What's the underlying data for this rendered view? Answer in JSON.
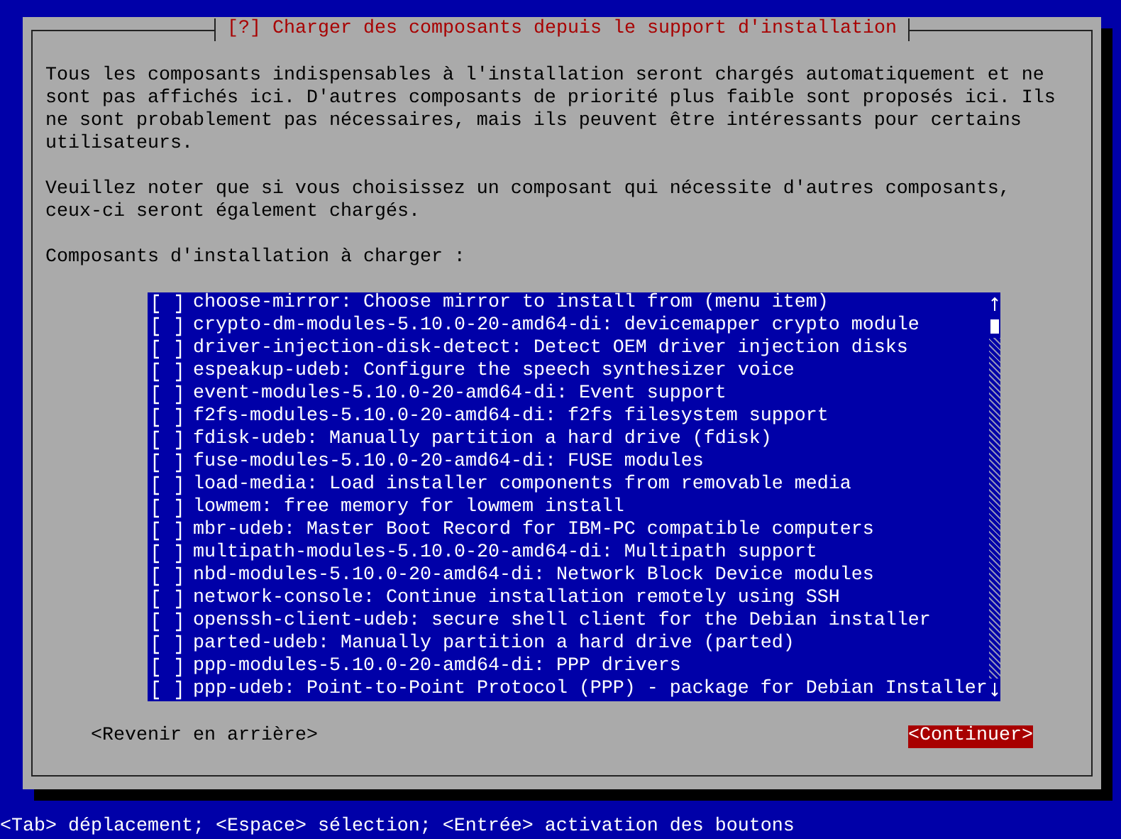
{
  "dialog": {
    "title": "[?] Charger des composants depuis le support d'installation",
    "paragraphs": [
      "Tous les composants indispensables à l'installation seront chargés automatiquement et ne sont pas affichés ici. D'autres composants de priorité plus faible sont proposés ici. Ils ne sont probablement pas nécessaires, mais ils peuvent être intéressants pour certains utilisateurs.",
      "Veuillez noter que si vous choisissez un composant qui nécessite d'autres composants, ceux-ci seront également chargés."
    ],
    "list_label": "Composants d'installation à charger :",
    "items": [
      {
        "label": "choose-mirror: Choose mirror to install from (menu item)",
        "checked": false
      },
      {
        "label": "crypto-dm-modules-5.10.0-20-amd64-di: devicemapper crypto module",
        "checked": false
      },
      {
        "label": "driver-injection-disk-detect: Detect OEM driver injection disks",
        "checked": false
      },
      {
        "label": "espeakup-udeb: Configure the speech synthesizer voice",
        "checked": false
      },
      {
        "label": "event-modules-5.10.0-20-amd64-di: Event support",
        "checked": false
      },
      {
        "label": "f2fs-modules-5.10.0-20-amd64-di: f2fs filesystem support",
        "checked": false
      },
      {
        "label": "fdisk-udeb: Manually partition a hard drive (fdisk)",
        "checked": false
      },
      {
        "label": "fuse-modules-5.10.0-20-amd64-di: FUSE modules",
        "checked": false
      },
      {
        "label": "load-media: Load installer components from removable media",
        "checked": false
      },
      {
        "label": "lowmem: free memory for lowmem install",
        "checked": false
      },
      {
        "label": "mbr-udeb: Master Boot Record for IBM-PC compatible computers",
        "checked": false
      },
      {
        "label": "multipath-modules-5.10.0-20-amd64-di: Multipath support",
        "checked": false
      },
      {
        "label": "nbd-modules-5.10.0-20-amd64-di: Network Block Device modules",
        "checked": false
      },
      {
        "label": "network-console: Continue installation remotely using SSH",
        "checked": false
      },
      {
        "label": "openssh-client-udeb: secure shell client for the Debian installer",
        "checked": false
      },
      {
        "label": "parted-udeb: Manually partition a hard drive (parted)",
        "checked": false
      },
      {
        "label": "ppp-modules-5.10.0-20-amd64-di: PPP drivers",
        "checked": false
      },
      {
        "label": "ppp-udeb: Point-to-Point Protocol (PPP) - package for Debian Installer",
        "checked": false
      }
    ],
    "buttons": [
      {
        "label": "<Revenir en arrière>",
        "selected": false
      },
      {
        "label": "<Continuer>",
        "selected": true
      }
    ]
  },
  "status_bar": "<Tab> déplacement; <Espace> sélection; <Entrée> activation des boutons"
}
